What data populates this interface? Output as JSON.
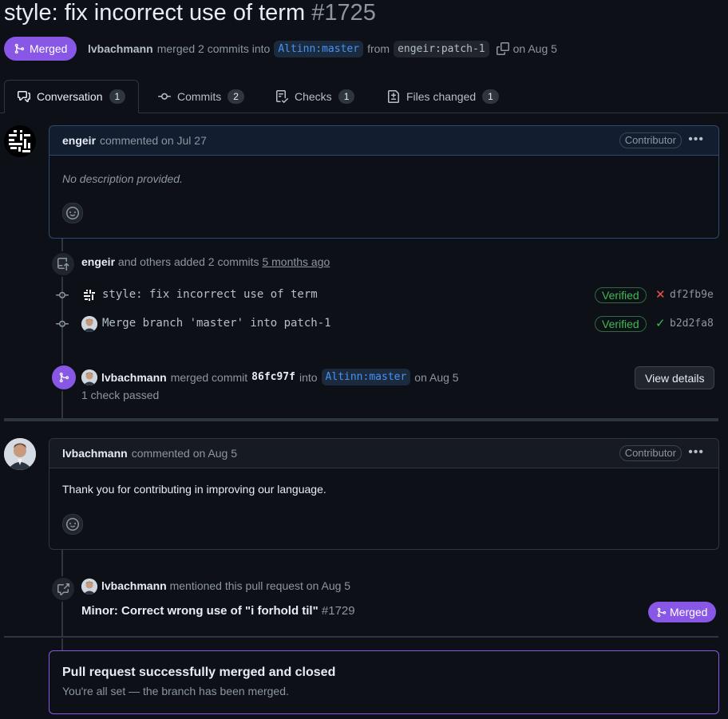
{
  "pr": {
    "title": "style: fix incorrect use of term",
    "number": "#1725",
    "state": "Merged",
    "merger": "lvbachmann",
    "merge_text": "merged 2 commits into",
    "base_branch": "Altinn:master",
    "from_text": "from",
    "head_branch": "engeir:patch-1",
    "merge_date": "on Aug 5"
  },
  "tabs": [
    {
      "label": "Conversation",
      "count": "1"
    },
    {
      "label": "Commits",
      "count": "2"
    },
    {
      "label": "Checks",
      "count": "1"
    },
    {
      "label": "Files changed",
      "count": "1"
    }
  ],
  "comment1": {
    "author": "engeir",
    "meta": "commented on Jul 27",
    "role": "Contributor",
    "body": "No description provided."
  },
  "commits_event": {
    "author": "engeir",
    "text": "and others added 2 commits",
    "time": "5 months ago",
    "commits": [
      {
        "message": "style: fix incorrect use of term",
        "verified": "Verified",
        "status": "fail",
        "sha": "df2fb9e"
      },
      {
        "message": "Merge branch 'master' into patch-1",
        "verified": "Verified",
        "status": "pass",
        "sha": "b2d2fa8"
      }
    ]
  },
  "merge_event": {
    "author": "lvbachmann",
    "text1": "merged commit",
    "sha": "86fc97f",
    "text2": "into",
    "branch": "Altinn:master",
    "date": "on Aug 5",
    "checks": "1 check passed",
    "button": "View details"
  },
  "comment2": {
    "author": "lvbachmann",
    "meta": "commented on Aug 5",
    "role": "Contributor",
    "body": "Thank you for contributing in improving our language."
  },
  "mention_event": {
    "author": "lvbachmann",
    "text": "mentioned this pull request on Aug 5",
    "ref_title": "Minor: Correct wrong use of \"i forhold til\"",
    "ref_number": "#1729",
    "ref_state": "Merged"
  },
  "merged_box": {
    "title": "Pull request successfully merged and closed",
    "subtitle": "You're all set — the branch has been merged."
  },
  "colors": {
    "merged_purple": "#8957e5",
    "link_blue": "#4493f8",
    "success_green": "#3fb950",
    "fail_red": "#f85149"
  }
}
